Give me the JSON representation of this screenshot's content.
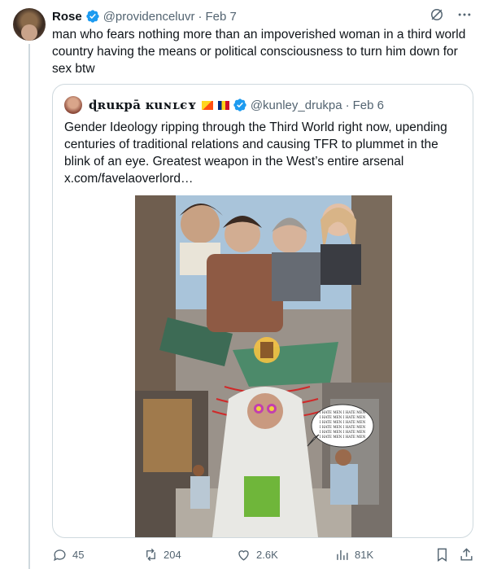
{
  "tweet": {
    "display_name": "Rose",
    "handle": "@providenceluvr",
    "separator": "·",
    "time": "Feb 7",
    "text": "man who fears nothing more than an impoverished woman in a third world country having the means or political consciousness to turn him down for sex btw"
  },
  "quote": {
    "display_name": "ɖʀuĸpā ĸuɴʟєʏ",
    "handle": "@kunley_drukpa",
    "separator": "·",
    "time": "Feb 6",
    "text": "Gender Ideology ripping through the Third World right now, upending centuries of traditional relations and causing TFR to plummet in the blink of an eye. Greatest weapon in the West’s entire arsenal  x.com/favelaoverlord…",
    "image_caption_lines": [
      "I HATE MEN I HATE MEN",
      "I HATE MEN I HATE MEN",
      "I HATE MEN I HATE MEN",
      "I HATE MEN I HATE MEN",
      "I HATE MEN I HATE MEN",
      "I HATE MEN I HATE MEN"
    ]
  },
  "actions": {
    "replies": "45",
    "reposts": "204",
    "likes": "2.6K",
    "views": "81K"
  },
  "colors": {
    "verified_blue": "#1d9bf0",
    "muted": "#536471",
    "border": "#cfd9de"
  }
}
